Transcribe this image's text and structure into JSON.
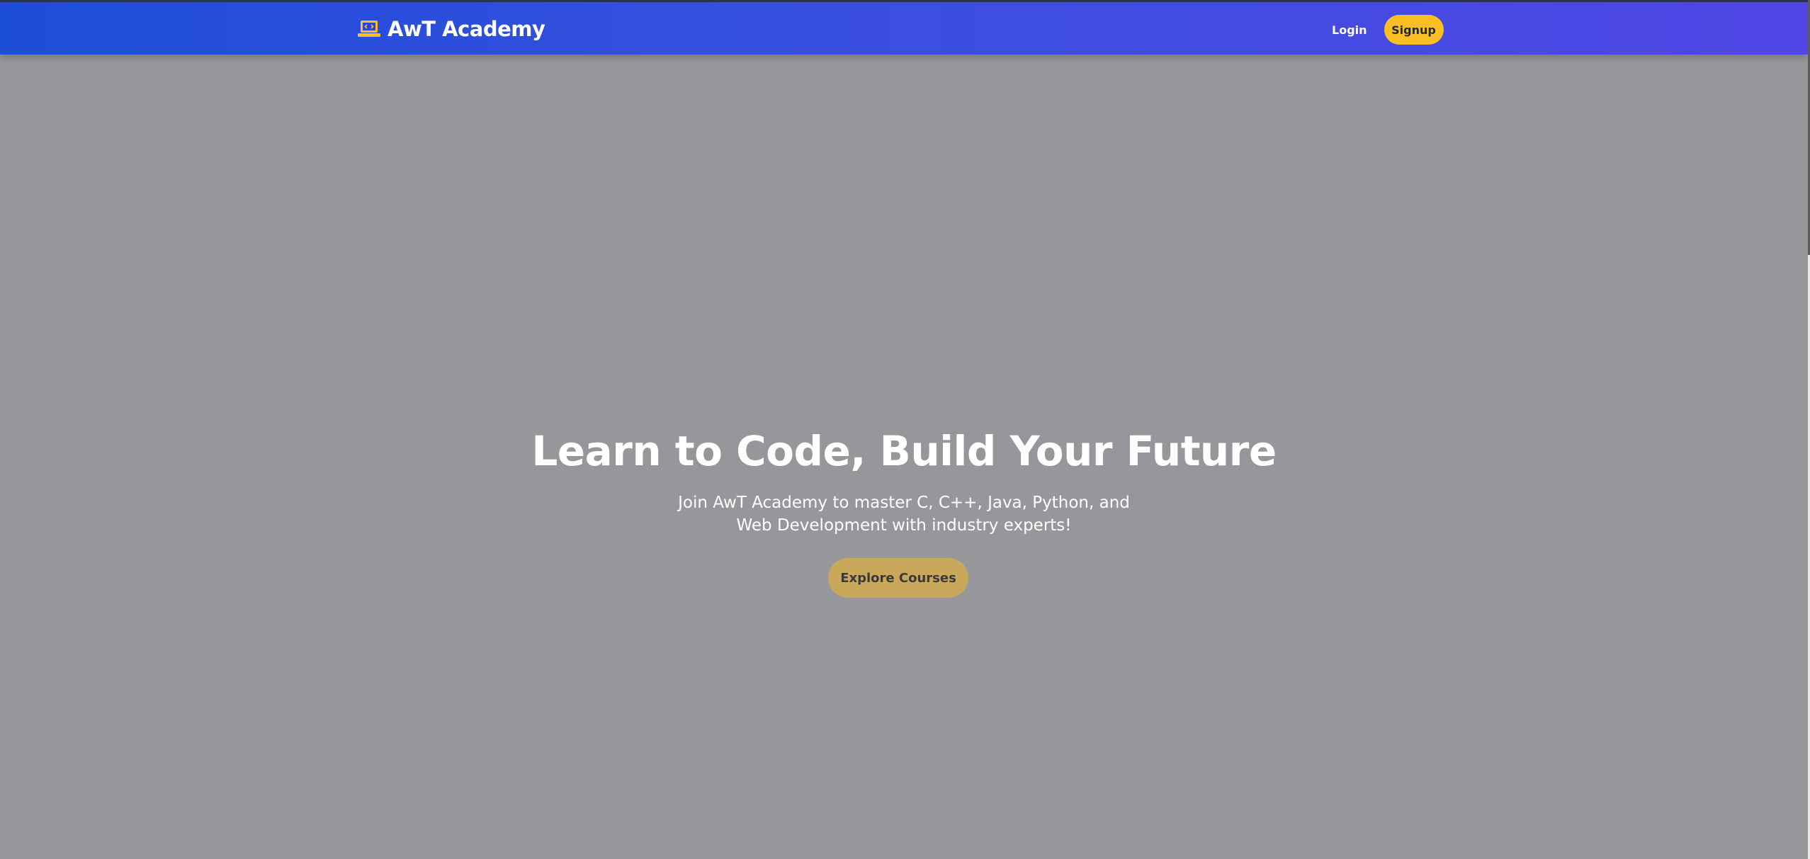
{
  "header": {
    "brand_name": "AwT Academy",
    "brand_icon": "laptop-code-icon",
    "login_label": "Login",
    "signup_label": "Signup"
  },
  "hero": {
    "title": "Learn to Code, Build Your Future",
    "subtitle": "Join AwT Academy to master C, C++, Java, Python, and Web Development with industry experts!",
    "cta_label": "Explore Courses"
  },
  "colors": {
    "navbar_gradient_start": "#1d4ed8",
    "navbar_gradient_end": "#4f46e5",
    "accent_yellow": "#fbbf24",
    "overlay_gray": "#96979a",
    "cta_muted": "#c9a85c"
  }
}
